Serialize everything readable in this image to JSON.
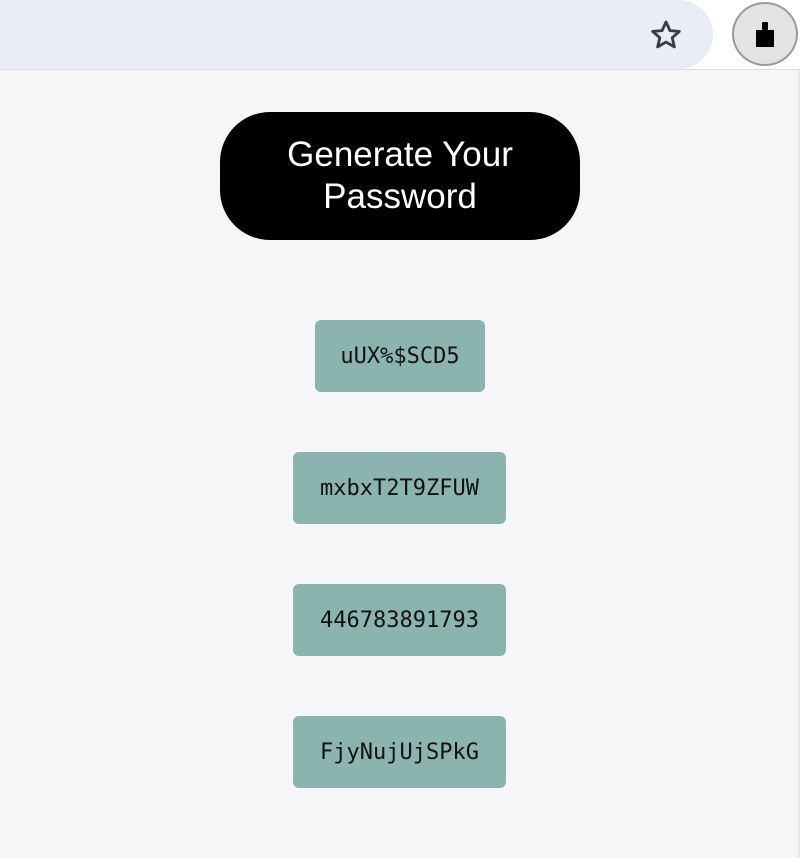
{
  "browser": {
    "bookmark_icon": "star-outline-icon",
    "extension_icon": "puzzle-icon"
  },
  "generator": {
    "button_label": "Generate Your Password",
    "passwords": [
      "uUX%$SCD5",
      "mxbxT2T9ZFUW",
      "446783891793",
      "FjyNujUjSPkG"
    ]
  },
  "colors": {
    "button_bg": "#000000",
    "password_bg": "#8cb4af",
    "page_bg": "#f6f5f8"
  }
}
